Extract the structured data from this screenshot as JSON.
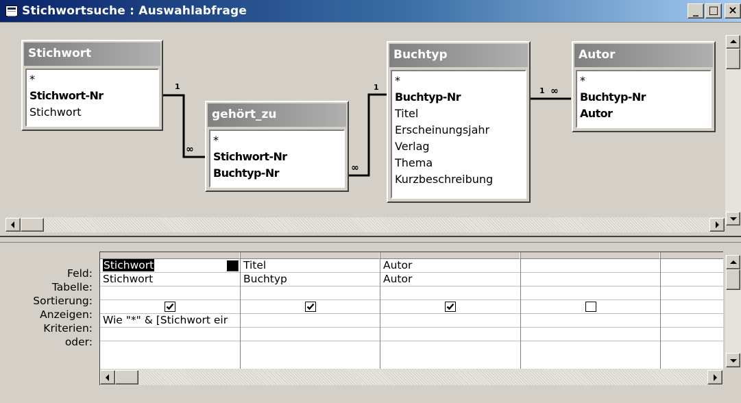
{
  "window": {
    "title": "Stichwortsuche : Auswahlabfrage",
    "buttons": {
      "minimize": "_",
      "maximize": "□",
      "close": "×"
    }
  },
  "tables": [
    {
      "name": "Stichwort",
      "fields": [
        {
          "label": "*",
          "key": false
        },
        {
          "label": "Stichwort-Nr",
          "key": true
        },
        {
          "label": "Stichwort",
          "key": false
        }
      ]
    },
    {
      "name": "gehört_zu",
      "fields": [
        {
          "label": "*",
          "key": false
        },
        {
          "label": "Stichwort-Nr",
          "key": true
        },
        {
          "label": "Buchtyp-Nr",
          "key": true
        }
      ]
    },
    {
      "name": "Buchtyp",
      "fields": [
        {
          "label": "*",
          "key": false
        },
        {
          "label": "Buchtyp-Nr",
          "key": true
        },
        {
          "label": "Titel",
          "key": false
        },
        {
          "label": "Erscheinungsjahr",
          "key": false
        },
        {
          "label": "Verlag",
          "key": false
        },
        {
          "label": "Thema",
          "key": false
        },
        {
          "label": "Kurzbeschreibung",
          "key": false
        }
      ]
    },
    {
      "name": "Autor",
      "fields": [
        {
          "label": "*",
          "key": false
        },
        {
          "label": "Buchtyp-Nr",
          "key": true
        },
        {
          "label": "Autor",
          "key": true
        }
      ]
    }
  ],
  "joins": [
    {
      "from": "Stichwort",
      "to": "gehört_zu",
      "from_symbol": "1",
      "to_symbol": "∞"
    },
    {
      "from": "gehört_zu",
      "to": "Buchtyp",
      "from_symbol": "∞",
      "to_symbol": "1"
    },
    {
      "from": "Buchtyp",
      "to": "Autor",
      "from_symbol": "1",
      "to_symbol": "∞"
    }
  ],
  "grid": {
    "row_labels": [
      "Feld:",
      "Tabelle:",
      "Sortierung:",
      "Anzeigen:",
      "Kriterien:",
      "oder:"
    ],
    "columns": [
      {
        "feld": "Stichwort",
        "tabelle": "Stichwort",
        "sortierung": "",
        "anzeigen": true,
        "kriterien": "Wie \"*\" & [Stichwort eir",
        "oder": ""
      },
      {
        "feld": "Titel",
        "tabelle": "Buchtyp",
        "sortierung": "",
        "anzeigen": true,
        "kriterien": "",
        "oder": ""
      },
      {
        "feld": "Autor",
        "tabelle": "Autor",
        "sortierung": "",
        "anzeigen": true,
        "kriterien": "",
        "oder": ""
      },
      {
        "feld": "",
        "tabelle": "",
        "sortierung": "",
        "anzeigen": false,
        "kriterien": "",
        "oder": ""
      },
      {
        "feld": "",
        "tabelle": "",
        "sortierung": "",
        "anzeigen": false,
        "kriterien": "",
        "oder": ""
      }
    ]
  }
}
